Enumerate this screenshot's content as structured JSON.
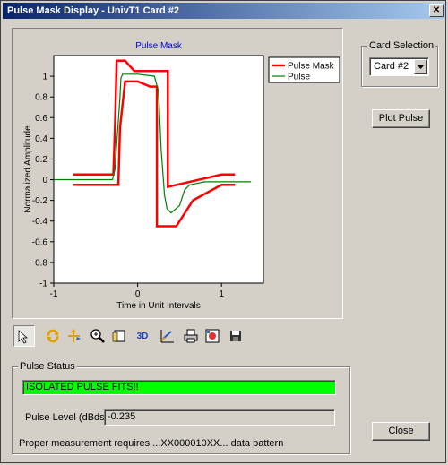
{
  "window": {
    "title": "Pulse Mask Display - UnivT1 Card #2",
    "close_glyph": "✕"
  },
  "card_selection": {
    "group_label": "Card Selection",
    "selected": "Card #2"
  },
  "buttons": {
    "plot_pulse": "Plot Pulse",
    "close": "Close"
  },
  "toolbar": {
    "icons": [
      "pointer-icon",
      "rotate-icon",
      "axis-scale-icon",
      "zoom-icon",
      "page-icon",
      "3d-icon",
      "chart-edit-icon",
      "print-icon",
      "export-image-icon",
      "save-icon"
    ],
    "label_3d": "3D"
  },
  "status": {
    "group_label": "Pulse Status",
    "message": "ISOLATED PULSE FITS!!",
    "pulse_level_label": "Pulse Level (dBdsx):",
    "pulse_level_value": "-0.235",
    "footnote": "Proper measurement requires ...XX000010XX... data pattern"
  },
  "colors": {
    "mask": "#ff0000",
    "pulse": "#008000",
    "status_ok": "#00ff00",
    "title_blue": "#0000ff"
  },
  "chart_data": {
    "type": "line",
    "title": "Pulse Mask",
    "xlabel": "Time in Unit Intervals",
    "ylabel": "Normalized Amplitude",
    "xlim": [
      -1,
      1.5
    ],
    "ylim": [
      -1,
      1.2
    ],
    "xticks": [
      -1,
      0,
      1
    ],
    "xtick_labels": [
      "-1",
      "0",
      "1"
    ],
    "yticks": [
      1,
      0.8,
      0.6,
      0.4,
      0.2,
      0,
      -0.2,
      -0.4,
      -0.6,
      -0.8,
      -1
    ],
    "ytick_labels": [
      "1",
      "0.8",
      "0.6",
      "0.4",
      "0.2",
      "0",
      "-0.2",
      "-0.4",
      "-0.6",
      "-0.8",
      "-1"
    ],
    "legend": [
      "Pulse Mask",
      "Pulse"
    ],
    "legend_position": "top-right",
    "series": [
      {
        "name": "Pulse Mask",
        "color": "#ff0000",
        "segment": "upper",
        "x": [
          -0.77,
          -0.29,
          -0.27,
          -0.25,
          -0.15,
          -0.04,
          0.36,
          0.36,
          1.0,
          1.16
        ],
        "y": [
          0.05,
          0.05,
          0.5,
          1.15,
          1.15,
          1.05,
          1.05,
          -0.07,
          0.05,
          0.05
        ]
      },
      {
        "name": "Pulse Mask",
        "color": "#ff0000",
        "segment": "lower",
        "x": [
          -0.77,
          -0.23,
          -0.21,
          -0.15,
          0.0,
          0.15,
          0.23,
          0.23,
          0.46,
          0.66,
          1.0,
          1.16
        ],
        "y": [
          -0.05,
          -0.05,
          0.5,
          0.95,
          0.95,
          0.9,
          0.9,
          -0.45,
          -0.45,
          -0.2,
          -0.05,
          -0.05
        ]
      },
      {
        "name": "Pulse",
        "color": "#008000",
        "x": [
          -1.0,
          -0.5,
          -0.3,
          -0.27,
          -0.24,
          -0.21,
          -0.2,
          -0.18,
          -0.1,
          0.0,
          0.1,
          0.2,
          0.25,
          0.28,
          0.32,
          0.35,
          0.4,
          0.5,
          0.56,
          0.62,
          0.8,
          1.0,
          1.35
        ],
        "y": [
          0.0,
          0.0,
          0.0,
          0.1,
          0.45,
          0.8,
          0.98,
          1.02,
          1.02,
          1.02,
          1.01,
          1.0,
          0.85,
          0.3,
          -0.15,
          -0.28,
          -0.32,
          -0.25,
          -0.1,
          -0.05,
          -0.02,
          -0.02,
          -0.02
        ]
      }
    ]
  }
}
